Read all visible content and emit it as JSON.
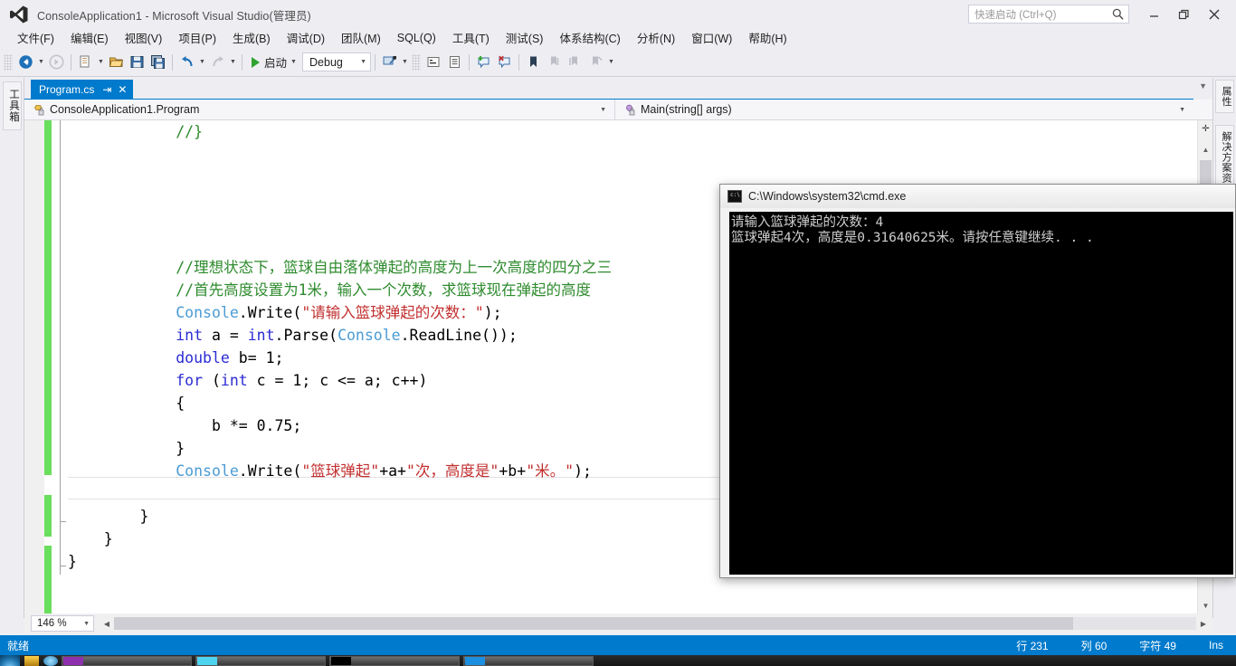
{
  "window": {
    "title": "ConsoleApplication1 - Microsoft Visual Studio(管理员)",
    "minimize": "─",
    "maximize": "❐",
    "close": "✕"
  },
  "quick_launch": {
    "placeholder": "快速启动 (Ctrl+Q)",
    "icon": "search-icon"
  },
  "menu": {
    "items": [
      {
        "label": "文件(F)"
      },
      {
        "label": "编辑(E)"
      },
      {
        "label": "视图(V)"
      },
      {
        "label": "项目(P)"
      },
      {
        "label": "生成(B)"
      },
      {
        "label": "调试(D)"
      },
      {
        "label": "团队(M)"
      },
      {
        "label": "SQL(Q)"
      },
      {
        "label": "工具(T)"
      },
      {
        "label": "测试(S)"
      },
      {
        "label": "体系结构(C)"
      },
      {
        "label": "分析(N)"
      },
      {
        "label": "窗口(W)"
      },
      {
        "label": "帮助(H)"
      }
    ]
  },
  "toolbar": {
    "back_icon": "navigate-back-icon",
    "forward_icon": "navigate-forward-icon",
    "new_project_icon": "new-project-icon",
    "open_file_icon": "open-file-icon",
    "save_icon": "save-icon",
    "save_all_icon": "save-all-icon",
    "undo_icon": "undo-icon",
    "redo_icon": "redo-icon",
    "start_label": "启动",
    "start_icon": "play-icon",
    "configuration": "Debug",
    "attach_icon": "attach-process-icon",
    "comment_icon": "comment-lines-icon",
    "uncomment_icon": "uncomment-lines-icon",
    "add_watch_icon": "add-watch-icon",
    "remove_watch_icon": "remove-watch-icon",
    "bookmark_icon": "bookmark-icon",
    "prev_bookmark_icon": "previous-bookmark-icon",
    "next_bookmark_icon": "next-bookmark-icon",
    "clear_bookmark_icon": "clear-bookmarks-icon",
    "overflow_icon": "toolbar-overflow-icon"
  },
  "left_dock": {
    "toolbox_label": "工具箱"
  },
  "right_dock": {
    "properties_label": "属性",
    "solution_explorer_label": "解决方案资源管理器"
  },
  "tabstrip": {
    "active_tab": "Program.cs",
    "pin_icon": "pin-icon",
    "close_icon": "close-tab-icon",
    "overflow_icon": "tab-overflow-icon"
  },
  "navbar": {
    "type_icon": "class-icon",
    "type_name": "ConsoleApplication1.Program",
    "member_icon": "method-icon",
    "member_name": "Main(string[] args)",
    "caret_icon": "chevron-down-icon"
  },
  "editor": {
    "zoom_level": "146 %",
    "zoom_caret_icon": "chevron-down-icon",
    "lines": [
      {
        "indent": 12,
        "parts": [
          {
            "t": "//}",
            "c": "cmt"
          }
        ]
      },
      {
        "indent": 0,
        "parts": []
      },
      {
        "indent": 0,
        "parts": []
      },
      {
        "indent": 0,
        "parts": []
      },
      {
        "indent": 0,
        "parts": []
      },
      {
        "indent": 0,
        "parts": []
      },
      {
        "indent": 12,
        "parts": [
          {
            "t": "//理想状态下，篮球自由落体弹起的高度为上一次高度的四分之三",
            "c": "cmt"
          }
        ]
      },
      {
        "indent": 12,
        "parts": [
          {
            "t": "//首先高度设置为1米，输入一个次数，求篮球现在弹起的高度",
            "c": "cmt"
          }
        ]
      },
      {
        "indent": 12,
        "parts": [
          {
            "t": "Console",
            "c": "typ"
          },
          {
            "t": ".Write(",
            "c": "plain"
          },
          {
            "t": "\"请输入篮球弹起的次数：\"",
            "c": "str"
          },
          {
            "t": ");",
            "c": "plain"
          }
        ]
      },
      {
        "indent": 12,
        "parts": [
          {
            "t": "int",
            "c": "kw"
          },
          {
            "t": " a = ",
            "c": "plain"
          },
          {
            "t": "int",
            "c": "kw"
          },
          {
            "t": ".Parse(",
            "c": "plain"
          },
          {
            "t": "Console",
            "c": "typ"
          },
          {
            "t": ".ReadLine());",
            "c": "plain"
          }
        ]
      },
      {
        "indent": 12,
        "parts": [
          {
            "t": "double",
            "c": "kw"
          },
          {
            "t": " b= 1;",
            "c": "plain"
          }
        ]
      },
      {
        "indent": 12,
        "parts": [
          {
            "t": "for",
            "c": "kw"
          },
          {
            "t": " (",
            "c": "plain"
          },
          {
            "t": "int",
            "c": "kw"
          },
          {
            "t": " c = 1; c <= a; c++)",
            "c": "plain"
          }
        ]
      },
      {
        "indent": 12,
        "parts": [
          {
            "t": "{",
            "c": "plain"
          }
        ]
      },
      {
        "indent": 16,
        "parts": [
          {
            "t": "b *= 0.75;",
            "c": "plain"
          }
        ]
      },
      {
        "indent": 12,
        "parts": [
          {
            "t": "}",
            "c": "plain"
          }
        ]
      },
      {
        "indent": 12,
        "parts": [
          {
            "t": "Console",
            "c": "typ"
          },
          {
            "t": ".Write(",
            "c": "plain"
          },
          {
            "t": "\"篮球弹起\"",
            "c": "str"
          },
          {
            "t": "+a+",
            "c": "plain"
          },
          {
            "t": "\"次，高度是\"",
            "c": "str"
          },
          {
            "t": "+b+",
            "c": "plain"
          },
          {
            "t": "\"米。\"",
            "c": "str"
          },
          {
            "t": ");",
            "c": "plain"
          }
        ]
      },
      {
        "indent": 0,
        "parts": []
      },
      {
        "indent": 8,
        "parts": [
          {
            "t": "}",
            "c": "plain"
          }
        ]
      },
      {
        "indent": 4,
        "parts": [
          {
            "t": "}",
            "c": "plain"
          }
        ]
      },
      {
        "indent": 0,
        "parts": [
          {
            "t": "}",
            "c": "plain"
          }
        ]
      }
    ],
    "current_line_index": 15
  },
  "console": {
    "icon": "cmd-icon",
    "title": "C:\\Windows\\system32\\cmd.exe",
    "output_lines": [
      "请输入篮球弹起的次数：4",
      "篮球弹起4次，高度是0.31640625米。请按任意键继续. . ."
    ]
  },
  "statusbar": {
    "ready": "就绪",
    "line_label": "行 231",
    "column_label": "列 60",
    "char_label": "字符 49",
    "insert_mode": "Ins"
  }
}
